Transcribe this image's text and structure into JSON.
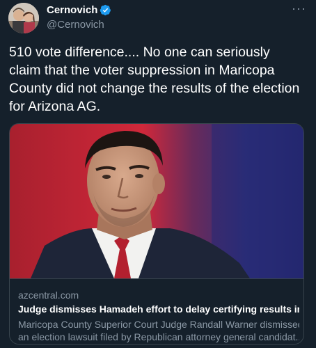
{
  "author": {
    "name": "Cernovich",
    "handle": "@Cernovich",
    "verified": true
  },
  "more_label": "···",
  "tweet_text": "510 vote difference.... No one can seriously claim that the voter suppression in Maricopa County did not change the results of the election for Arizona AG.",
  "card": {
    "domain": "azcentral.com",
    "title": "Judge dismisses Hamadeh effort to delay certifying results in att...",
    "description_line1": "Maricopa County Superior Court Judge Randall Warner dismissed",
    "description_line2": "an election lawsuit filed by Republican attorney general candidat..."
  },
  "colors": {
    "background": "#15202b",
    "text": "#ffffff",
    "secondary_text": "#8b98a5",
    "border": "#38444d",
    "verified_blue": "#1d9bf0"
  }
}
